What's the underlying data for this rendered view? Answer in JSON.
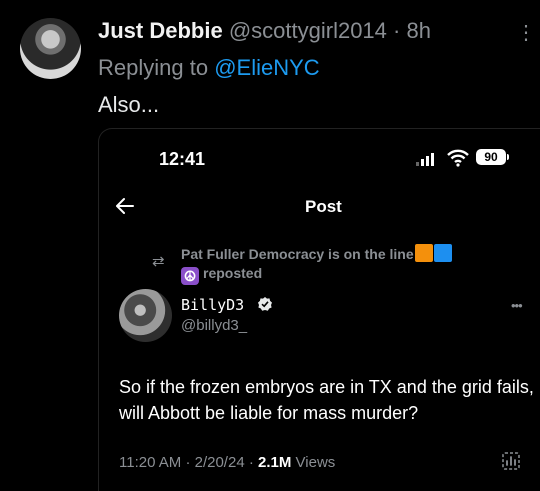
{
  "outer_tweet": {
    "author_name": "Just Debbie",
    "author_handle": "@scottygirl2014",
    "separator": "·",
    "time_ago": "8h",
    "replying_prefix": "Replying to",
    "replying_to": "@ElieNYC",
    "text": "Also..."
  },
  "screenshot": {
    "status_time": "12:41",
    "battery": "90",
    "nav_title": "Post",
    "repost_line1": "Pat Fuller Democracy is on the line",
    "repost_line2": "reposted",
    "author_name": "BillyD3",
    "author_handle": "@billyd3_",
    "text": "So if the frozen embryos are in TX and the grid fails, will Abbott be liable for mass murder?",
    "time": "11:20 AM",
    "date": "2/20/24",
    "dot": "·",
    "views_count": "2.1M",
    "views_label": "Views"
  },
  "icons": {
    "back": "arrow-left-icon",
    "verified": "verified-badge-icon",
    "repost": "repost-icon",
    "analytics": "analytics-icon",
    "peace": "peace-symbol-emoji",
    "squares": [
      "orange-square-emoji",
      "blue-square-emoji"
    ]
  },
  "colors": {
    "background": "#000000",
    "link": "#1d9bf0",
    "secondary_text": "#8b8f94",
    "orange_square": "#f4900c",
    "blue_square": "#1d8ff0",
    "peace_purple": "#8a4fc9"
  }
}
